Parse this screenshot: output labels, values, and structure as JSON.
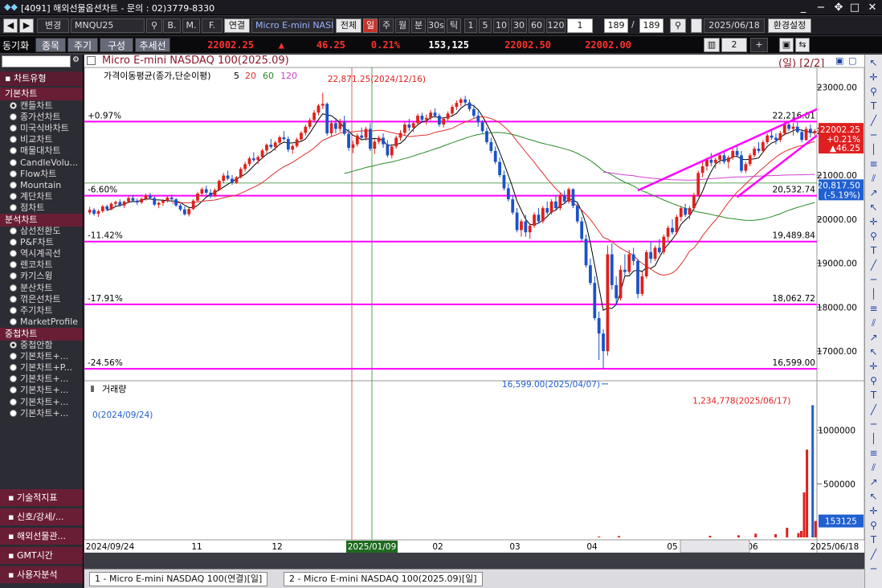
{
  "window": {
    "title": "[4091] 해외선물옵션차트 - 문의 : 02)3779-8330"
  },
  "toolbar": {
    "nav_prev": "◀",
    "nav_next": "▶",
    "change_label": "변경",
    "symbol_code": "MNQU25",
    "btn_b": "B.",
    "btn_m": "M.",
    "btn_f": "F.",
    "link_label": "연결",
    "symbol_name": "Micro E-mini NASDAQ",
    "all_label": "전체",
    "periods": [
      "일",
      "주",
      "월",
      "분",
      "30s",
      "틱"
    ],
    "intervals": [
      "1",
      "5",
      "10",
      "30",
      "60",
      "120"
    ],
    "interval_value": "1",
    "count_value": "189",
    "count_total": "189",
    "date_value": "2025/06/18",
    "settings_label": "환경설정"
  },
  "quotebar": {
    "sync_label": "동기화",
    "tabs": [
      "종목",
      "주기",
      "구성",
      "추세선"
    ],
    "last_price": "22002.25",
    "change_arrow": "▲",
    "change_value": "46.25",
    "change_pct": "0.21%",
    "volume": "153,125",
    "bid": "22002.50",
    "ask": "22002.00",
    "layout_count": "2",
    "add_label": "+"
  },
  "left_panel": {
    "section_chart_type": "차트유형",
    "basic_header": "기본차트",
    "basic_items": [
      "캔들차트",
      "종가선차트",
      "미국식바차트",
      "비교차트",
      "매물대차트",
      "CandleVolu...",
      "Flow차트",
      "Mountain",
      "계단차트",
      "점차트"
    ],
    "analysis_header": "분석차트",
    "analysis_items": [
      "삼선전환도",
      "P&F차트",
      "역시계곡선",
      "렌코차트",
      "카기스윙",
      "분산차트",
      "꺾은선차트",
      "주기차트",
      "MarketProfile"
    ],
    "overlay_header": "중첩차트",
    "overlay_items": [
      "중첩안함",
      "기본차트+...",
      "기본차트+P...",
      "기본차트+...",
      "기본차트+...",
      "기본차트+...",
      "기본차트+..."
    ],
    "bottom_buttons": [
      "기술적지표",
      "신호/강세/...",
      "해외선물관...",
      "GMT시간",
      "사용자분석"
    ]
  },
  "chart_header": {
    "title": "Micro E-mini NASDAQ 100(2025.09)",
    "period_info": "(일) [2/2]"
  },
  "colors": {
    "up": "#e0201c",
    "down": "#1a52c8",
    "fib_line": "#ff00ff",
    "ma5": "#000000",
    "ma20": "#e03030",
    "ma60": "#2a8a2a",
    "ma120": "#d040d0",
    "accent_price": "#e02020",
    "accent_blue": "#2060d0"
  },
  "chart_data": {
    "type": "candlestick",
    "price_panel": {
      "ma_legend_label": "가격이동평균(종가,단순이평)",
      "ma_periods": [
        "5",
        "20",
        "60",
        "120"
      ],
      "ylim": [
        16400,
        23300
      ],
      "yticks": [
        "23000.00",
        "22000.00",
        "21000.00",
        "20000.00",
        "19000.00",
        "18000.00",
        "17000.00"
      ],
      "ytick_values": [
        23000,
        22000,
        21000,
        20000,
        19000,
        18000,
        17000
      ],
      "fib_levels": [
        {
          "pct": "+0.97%",
          "value": "22,216.01",
          "price": 22216.01
        },
        {
          "pct": "-6.60%",
          "value": "20,532.74",
          "price": 20532.74
        },
        {
          "pct": "-11.42%",
          "value": "19,489.84",
          "price": 19489.84
        },
        {
          "pct": "-17.91%",
          "value": "18,062.72",
          "price": 18062.72
        },
        {
          "pct": "-24.56%",
          "value": "16,599.00",
          "price": 16599.0
        }
      ],
      "high_annotation": "22,871.25(2024/12/16)",
      "low_annotation": "16,599.00(2025/04/07)",
      "last_price_label": "22002.25",
      "last_change_pct": "+0.21%",
      "last_change": "▲46.25",
      "ma_label_value": "20,817.50",
      "ma_label_pct": "(-5.19%)"
    },
    "volume_panel": {
      "title": "거래량",
      "yticks": [
        "1000000",
        "500000"
      ],
      "ytick_values": [
        1000000,
        500000
      ],
      "ylim": [
        0,
        1350000
      ],
      "max_annotation": "1,234,778(2025/06/17)",
      "min_annotation": "0(2024/09/24)",
      "last_volume_label": "153125"
    },
    "x_labels": [
      "2024/09/24",
      "11",
      "12",
      "2025/01/09",
      "02",
      "03",
      "04",
      "05",
      "06",
      "2025/06/18"
    ],
    "candles": [
      [
        20150,
        20280,
        20100,
        20210
      ],
      [
        20210,
        20250,
        20080,
        20120
      ],
      [
        20120,
        20220,
        20050,
        20180
      ],
      [
        20180,
        20320,
        20140,
        20290
      ],
      [
        20290,
        20330,
        20180,
        20220
      ],
      [
        20220,
        20380,
        20200,
        20350
      ],
      [
        20350,
        20420,
        20300,
        20390
      ],
      [
        20390,
        20450,
        20280,
        20310
      ],
      [
        20310,
        20420,
        20250,
        20400
      ],
      [
        20400,
        20520,
        20360,
        20480
      ],
      [
        20480,
        20550,
        20400,
        20420
      ],
      [
        20420,
        20470,
        20320,
        20380
      ],
      [
        20380,
        20490,
        20340,
        20460
      ],
      [
        20460,
        20580,
        20420,
        20540
      ],
      [
        20540,
        20600,
        20450,
        20480
      ],
      [
        20480,
        20520,
        20300,
        20330
      ],
      [
        20330,
        20400,
        20250,
        20370
      ],
      [
        20370,
        20450,
        20300,
        20420
      ],
      [
        20420,
        20520,
        20380,
        20490
      ],
      [
        20490,
        20560,
        20420,
        20450
      ],
      [
        20450,
        20480,
        20280,
        20310
      ],
      [
        20310,
        20350,
        20180,
        20220
      ],
      [
        20220,
        20290,
        20080,
        20110
      ],
      [
        20110,
        20260,
        20060,
        20230
      ],
      [
        20230,
        20450,
        20200,
        20420
      ],
      [
        20420,
        20620,
        20380,
        20580
      ],
      [
        20580,
        20720,
        20520,
        20680
      ],
      [
        20680,
        20760,
        20560,
        20600
      ],
      [
        20600,
        20680,
        20480,
        20520
      ],
      [
        20520,
        20700,
        20500,
        20660
      ],
      [
        20660,
        20900,
        20640,
        20870
      ],
      [
        20870,
        21050,
        20820,
        20990
      ],
      [
        20990,
        21100,
        20880,
        20920
      ],
      [
        20920,
        21000,
        20780,
        20830
      ],
      [
        20830,
        20980,
        20800,
        20950
      ],
      [
        20950,
        21180,
        20920,
        21140
      ],
      [
        21140,
        21300,
        21080,
        21250
      ],
      [
        21250,
        21420,
        21200,
        21380
      ],
      [
        21380,
        21520,
        21300,
        21340
      ],
      [
        21340,
        21450,
        21250,
        21410
      ],
      [
        21410,
        21600,
        21380,
        21560
      ],
      [
        21560,
        21720,
        21500,
        21690
      ],
      [
        21690,
        21820,
        21600,
        21640
      ],
      [
        21640,
        21780,
        21560,
        21740
      ],
      [
        21740,
        21900,
        21680,
        21860
      ],
      [
        21860,
        22000,
        21780,
        21820
      ],
      [
        21820,
        21880,
        21520,
        21580
      ],
      [
        21580,
        21700,
        21480,
        21660
      ],
      [
        21660,
        21850,
        21620,
        21810
      ],
      [
        21810,
        22000,
        21780,
        21960
      ],
      [
        21960,
        22150,
        21900,
        22100
      ],
      [
        22100,
        22300,
        22050,
        22250
      ],
      [
        22250,
        22480,
        22200,
        22420
      ],
      [
        22420,
        22620,
        22360,
        22580
      ],
      [
        22580,
        22871,
        22500,
        22620
      ],
      [
        22620,
        22650,
        21900,
        21950
      ],
      [
        21950,
        22250,
        21880,
        22180
      ],
      [
        22180,
        22300,
        21950,
        22050
      ],
      [
        22050,
        22280,
        21980,
        22200
      ],
      [
        22200,
        22350,
        21900,
        21940
      ],
      [
        21940,
        22050,
        21550,
        21620
      ],
      [
        21620,
        21780,
        21500,
        21700
      ],
      [
        21700,
        21950,
        21650,
        21900
      ],
      [
        21900,
        22080,
        21820,
        21850
      ],
      [
        21850,
        22100,
        21780,
        22050
      ],
      [
        22050,
        22180,
        21550,
        21600
      ],
      [
        21600,
        21820,
        21480,
        21760
      ],
      [
        21760,
        21900,
        21700,
        21850
      ],
      [
        21850,
        21950,
        21620,
        21700
      ],
      [
        21700,
        21800,
        21400,
        21450
      ],
      [
        21450,
        21700,
        21380,
        21650
      ],
      [
        21650,
        21900,
        21600,
        21850
      ],
      [
        21850,
        22020,
        21780,
        21960
      ],
      [
        21960,
        22200,
        21900,
        22150
      ],
      [
        22150,
        22280,
        22000,
        22080
      ],
      [
        22080,
        22220,
        21980,
        22180
      ],
      [
        22180,
        22400,
        22120,
        22350
      ],
      [
        22350,
        22420,
        22200,
        22260
      ],
      [
        22260,
        22380,
        22150,
        22300
      ],
      [
        22300,
        22480,
        22250,
        22420
      ],
      [
        22420,
        22520,
        22300,
        22350
      ],
      [
        22350,
        22400,
        22100,
        22150
      ],
      [
        22150,
        22320,
        22080,
        22280
      ],
      [
        22280,
        22450,
        22220,
        22400
      ],
      [
        22400,
        22600,
        22350,
        22550
      ],
      [
        22550,
        22700,
        22480,
        22640
      ],
      [
        22640,
        22760,
        22560,
        22720
      ],
      [
        22720,
        22800,
        22580,
        22650
      ],
      [
        22650,
        22720,
        22450,
        22500
      ],
      [
        22500,
        22600,
        22300,
        22350
      ],
      [
        22350,
        22450,
        22100,
        22200
      ],
      [
        22200,
        22250,
        21950,
        22000
      ],
      [
        22000,
        22080,
        21700,
        21750
      ],
      [
        21750,
        21850,
        21500,
        21550
      ],
      [
        21550,
        21650,
        21250,
        21300
      ],
      [
        21300,
        21400,
        20950,
        21000
      ],
      [
        21000,
        21100,
        20650,
        20700
      ],
      [
        20700,
        20800,
        20400,
        20450
      ],
      [
        20450,
        20550,
        20100,
        20150
      ],
      [
        20150,
        20250,
        19700,
        19750
      ],
      [
        19750,
        20000,
        19600,
        19950
      ],
      [
        19950,
        20100,
        19600,
        19700
      ],
      [
        19700,
        19900,
        19550,
        19850
      ],
      [
        19850,
        20150,
        19800,
        20100
      ],
      [
        20100,
        20250,
        19900,
        19950
      ],
      [
        19950,
        20300,
        19900,
        20250
      ],
      [
        20250,
        20400,
        20100,
        20150
      ],
      [
        20150,
        20450,
        20100,
        20400
      ],
      [
        20400,
        20550,
        20200,
        20250
      ],
      [
        20250,
        20600,
        20200,
        20550
      ],
      [
        20550,
        20650,
        20350,
        20400
      ],
      [
        20400,
        20720,
        20350,
        20680
      ],
      [
        20680,
        20700,
        20250,
        20300
      ],
      [
        20300,
        20400,
        19900,
        19950
      ],
      [
        19950,
        20050,
        19500,
        19550
      ],
      [
        19550,
        19650,
        18900,
        18950
      ],
      [
        18950,
        19100,
        18500,
        18550
      ],
      [
        18550,
        18700,
        17700,
        17750
      ],
      [
        17750,
        17900,
        16800,
        17400
      ],
      [
        17400,
        17500,
        16599,
        17000
      ],
      [
        17000,
        19400,
        16900,
        19200
      ],
      [
        19200,
        19450,
        18400,
        18500
      ],
      [
        18500,
        18700,
        18050,
        18200
      ],
      [
        18200,
        18950,
        18150,
        18850
      ],
      [
        18850,
        19200,
        18700,
        18800
      ],
      [
        18800,
        19300,
        18750,
        19200
      ],
      [
        19200,
        19350,
        18950,
        19050
      ],
      [
        19050,
        19100,
        18200,
        18300
      ],
      [
        18300,
        18800,
        18250,
        18700
      ],
      [
        18700,
        19300,
        18650,
        19250
      ],
      [
        19250,
        19500,
        19000,
        19100
      ],
      [
        19100,
        19400,
        19050,
        19350
      ],
      [
        19350,
        19550,
        19200,
        19250
      ],
      [
        19250,
        19650,
        19200,
        19600
      ],
      [
        19600,
        19850,
        19500,
        19800
      ],
      [
        19800,
        20000,
        19650,
        19700
      ],
      [
        19700,
        20100,
        19650,
        20050
      ],
      [
        20050,
        20300,
        19950,
        20250
      ],
      [
        20250,
        20350,
        20050,
        20100
      ],
      [
        20100,
        20300,
        20000,
        20250
      ],
      [
        20250,
        20600,
        20200,
        20550
      ],
      [
        20550,
        21100,
        20500,
        21050
      ],
      [
        21050,
        21300,
        20950,
        21200
      ],
      [
        21200,
        21400,
        21100,
        21350
      ],
      [
        21350,
        21500,
        21200,
        21280
      ],
      [
        21280,
        21400,
        21150,
        21350
      ],
      [
        21350,
        21500,
        21250,
        21450
      ],
      [
        21450,
        21550,
        21250,
        21300
      ],
      [
        21300,
        21450,
        21150,
        21400
      ],
      [
        21400,
        21600,
        21350,
        21550
      ],
      [
        21550,
        21650,
        21400,
        21450
      ],
      [
        21450,
        21550,
        21050,
        21100
      ],
      [
        21100,
        21300,
        21050,
        21250
      ],
      [
        21250,
        21500,
        21200,
        21450
      ],
      [
        21450,
        21650,
        21400,
        21600
      ],
      [
        21600,
        21750,
        21500,
        21550
      ],
      [
        21550,
        21800,
        21500,
        21750
      ],
      [
        21750,
        21950,
        21700,
        21900
      ],
      [
        21900,
        22050,
        21800,
        21850
      ],
      [
        21850,
        21950,
        21700,
        21800
      ],
      [
        21800,
        22000,
        21750,
        21950
      ],
      [
        21950,
        22200,
        21900,
        22150
      ],
      [
        22150,
        22216,
        22000,
        22050
      ],
      [
        22050,
        22180,
        21900,
        22100
      ],
      [
        22100,
        22200,
        21950,
        21980
      ],
      [
        21980,
        22050,
        21750,
        21800
      ],
      [
        21800,
        22100,
        21780,
        22050
      ],
      [
        22050,
        22150,
        21850,
        21956
      ],
      [
        21956,
        22050,
        21900,
        22002
      ]
    ],
    "volumes": [
      0,
      0,
      0,
      0,
      0,
      0,
      0,
      0,
      0,
      0,
      0,
      0,
      0,
      0,
      0,
      0,
      0,
      0,
      0,
      0,
      0,
      0,
      0,
      0,
      0,
      0,
      0,
      0,
      0,
      0,
      0,
      0,
      0,
      0,
      0,
      0,
      0,
      0,
      0,
      0,
      0,
      0,
      0,
      0,
      0,
      0,
      0,
      0,
      0,
      0,
      0,
      0,
      0,
      0,
      0,
      0,
      0,
      0,
      0,
      0,
      0,
      0,
      0,
      0,
      0,
      0,
      0,
      0,
      0,
      0,
      0,
      0,
      0,
      0,
      0,
      0,
      0,
      0,
      0,
      0,
      0,
      0,
      0,
      0,
      0,
      0,
      0,
      0,
      0,
      0,
      0,
      0,
      0,
      0,
      0,
      0,
      0,
      0,
      0,
      0,
      0,
      0,
      0,
      0,
      0,
      0,
      0,
      0,
      0,
      0,
      0,
      0,
      0,
      0,
      0,
      0,
      0,
      0,
      0,
      0,
      0,
      0,
      0,
      0,
      0,
      0,
      0,
      0,
      0,
      0,
      0,
      0,
      0,
      0,
      0,
      0,
      0,
      0,
      0,
      0,
      0,
      0,
      0,
      0,
      0,
      0,
      0,
      0,
      0,
      0,
      0,
      0,
      0,
      0,
      0,
      0,
      0,
      0,
      0,
      0,
      0,
      0,
      0,
      0,
      0,
      0,
      0,
      0,
      0,
      0,
      0,
      0,
      0,
      0,
      0,
      0,
      0,
      0,
      0,
      8000,
      0,
      0,
      0,
      0,
      0,
      0,
      12000,
      0,
      0,
      0,
      0,
      0,
      0,
      0,
      0,
      0,
      0,
      0,
      0,
      0,
      0,
      0,
      0,
      0,
      0,
      0,
      0,
      0,
      0,
      0,
      0,
      0,
      0,
      0,
      0,
      0,
      0,
      0,
      15000,
      0,
      0,
      0,
      0,
      0,
      0,
      0,
      0,
      0,
      20000,
      0,
      0,
      0,
      0,
      0,
      35000,
      0,
      0,
      0,
      0,
      0,
      0,
      30000,
      0,
      0,
      0,
      90000,
      0,
      0,
      0,
      40000,
      60000,
      420000,
      820000,
      0,
      1234778,
      153125
    ]
  },
  "bottom_tabs": [
    "1 - Micro E-mini NASDAQ 100(연결)[일]",
    "2 - Micro E-mini NASDAQ 100(2025.09)[일]"
  ],
  "right_toolbar": {
    "icons": [
      "pointer-icon",
      "crosshair-icon",
      "zoom-icon",
      "text-icon",
      "trendline-icon",
      "horizontal-line-icon",
      "vertical-line-icon",
      "fibonacci-icon",
      "channel-icon",
      "arrow-icon",
      "delete-icon"
    ]
  }
}
